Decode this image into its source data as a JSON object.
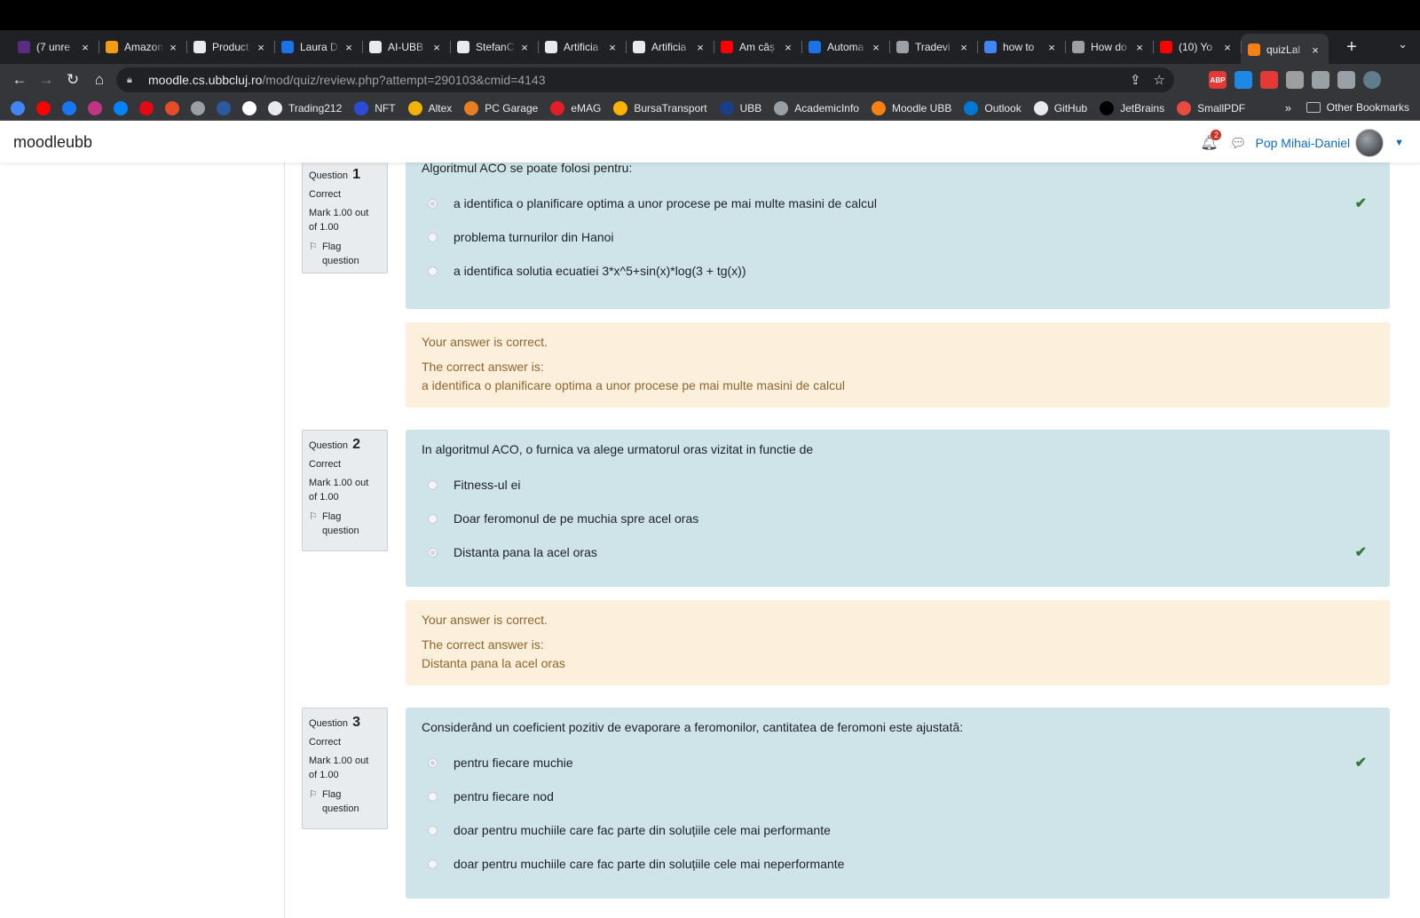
{
  "browser": {
    "tabs": [
      {
        "title": "(7 unre",
        "icon_color": "#5b2c83",
        "active": false
      },
      {
        "title": "Amazon",
        "icon_color": "#f39c12",
        "active": false
      },
      {
        "title": "Product",
        "icon_color": "#e8eaed",
        "active": false
      },
      {
        "title": "Laura D",
        "icon_color": "#1a73e8",
        "active": false
      },
      {
        "title": "AI-UBB",
        "icon_color": "#e8eaed",
        "active": false
      },
      {
        "title": "StefanC",
        "icon_color": "#e8eaed",
        "active": false
      },
      {
        "title": "Artificia",
        "icon_color": "#e8eaed",
        "active": false
      },
      {
        "title": "Artificia",
        "icon_color": "#e8eaed",
        "active": false
      },
      {
        "title": "Am câș",
        "icon_color": "#ff0000",
        "active": false
      },
      {
        "title": "Automa",
        "icon_color": "#1a73e8",
        "active": false
      },
      {
        "title": "Tradevi",
        "icon_color": "#9aa0a6",
        "active": false
      },
      {
        "title": "how to",
        "icon_color": "#4285f4",
        "active": false
      },
      {
        "title": "How do",
        "icon_color": "#9aa0a6",
        "active": false
      },
      {
        "title": "(10) Yo",
        "icon_color": "#ff0000",
        "active": false
      },
      {
        "title": "quizLal",
        "icon_color": "#f98012",
        "active": true
      }
    ],
    "tab_close": "×",
    "new_tab": "+",
    "url_host": "moodle.cs.ubbcluj.ro",
    "url_path": "/mod/quiz/review.php?attempt=290103&cmid=4143",
    "bookmarks": [
      {
        "label": "Trading212",
        "color": "#e8eaed"
      },
      {
        "label": "NFT",
        "color": "#2b4bd8"
      },
      {
        "label": "Altex",
        "color": "#f0b400"
      },
      {
        "label": "PC Garage",
        "color": "#e67e22"
      },
      {
        "label": "eMAG",
        "color": "#e31e24"
      },
      {
        "label": "BursaTransport",
        "color": "#ffb300"
      },
      {
        "label": "UBB",
        "color": "#1a3e8a"
      },
      {
        "label": "AcademicInfo",
        "color": "#9aa0a6"
      },
      {
        "label": "Moodle UBB",
        "color": "#f98012"
      },
      {
        "label": "Outlook",
        "color": "#0078d4"
      },
      {
        "label": "GitHub",
        "color": "#e8eaed"
      },
      {
        "label": "JetBrains",
        "color": "#000000"
      },
      {
        "label": "SmallPDF",
        "color": "#e84c3d"
      }
    ],
    "bookmark_icons": [
      "#4285f4",
      "#ff0000",
      "#1877f2",
      "#c13584",
      "#0084ff",
      "#e50914",
      "#e44d26",
      "#9aa0a6",
      "#2c5aa0",
      "#ffffff"
    ],
    "bookmarks_more": "»",
    "other_bookmarks": "Other Bookmarks",
    "ext_icons": [
      "#e53935",
      "#1e88e5",
      "#e53935",
      "#9e9e9e",
      "#9aa0a6",
      "#9aa0a6",
      "#607d8b"
    ],
    "ext_abp": "ABP"
  },
  "moodle": {
    "brand": "moodleubb",
    "notification_count": "2",
    "user_name": "Pop Mihai-Daniel"
  },
  "questions": [
    {
      "label": "Question",
      "number": "1",
      "state": "Correct",
      "grade_line1": "Mark 1.00 out",
      "grade_line2": "of 1.00",
      "flag_line1": "Flag",
      "flag_line2": "question",
      "text": "Algoritmul ACO se poate folosi pentru:",
      "answers": [
        {
          "text": "a identifica o planificare optima a unor procese pe mai multe masini de calcul",
          "checked": true,
          "correct": true
        },
        {
          "text": "problema turnurilor din Hanoi",
          "checked": false,
          "correct": false
        },
        {
          "text": "a identifica solutia ecuatiei 3*x^5+sin(x)*log(3 + tg(x))",
          "checked": false,
          "correct": false
        }
      ],
      "feedback_status": "Your answer is correct.",
      "feedback_label": "The correct answer is:",
      "feedback_answer": "a identifica o planificare optima a unor procese pe mai multe masini de calcul"
    },
    {
      "label": "Question",
      "number": "2",
      "state": "Correct",
      "grade_line1": "Mark 1.00 out",
      "grade_line2": "of 1.00",
      "flag_line1": "Flag",
      "flag_line2": "question",
      "text": "In algoritmul ACO, o furnica va alege urmatorul oras vizitat in functie de",
      "answers": [
        {
          "text": "Fitness-ul ei",
          "checked": false,
          "correct": false
        },
        {
          "text": "Doar feromonul de pe muchia spre acel oras",
          "checked": false,
          "correct": false
        },
        {
          "text": "Distanta pana la acel oras",
          "checked": true,
          "correct": true
        }
      ],
      "feedback_status": "Your answer is correct.",
      "feedback_label": "The correct answer is:",
      "feedback_answer": "Distanta pana la acel oras"
    },
    {
      "label": "Question",
      "number": "3",
      "state": "Correct",
      "grade_line1": "Mark 1.00 out",
      "grade_line2": "of 1.00",
      "flag_line1": "Flag",
      "flag_line2": "question",
      "text": "Considerând un coeficient pozitiv de evaporare a feromonilor, cantitatea de feromoni este ajustată:",
      "answers": [
        {
          "text": "pentru fiecare muchie",
          "checked": true,
          "correct": true
        },
        {
          "text": "pentru fiecare nod",
          "checked": false,
          "correct": false
        },
        {
          "text": "doar pentru muchiile care fac parte din soluțiile cele mai performante",
          "checked": false,
          "correct": false
        },
        {
          "text": "doar pentru muchiile care fac parte din soluțiile cele mai neperformante",
          "checked": false,
          "correct": false
        }
      ]
    }
  ]
}
